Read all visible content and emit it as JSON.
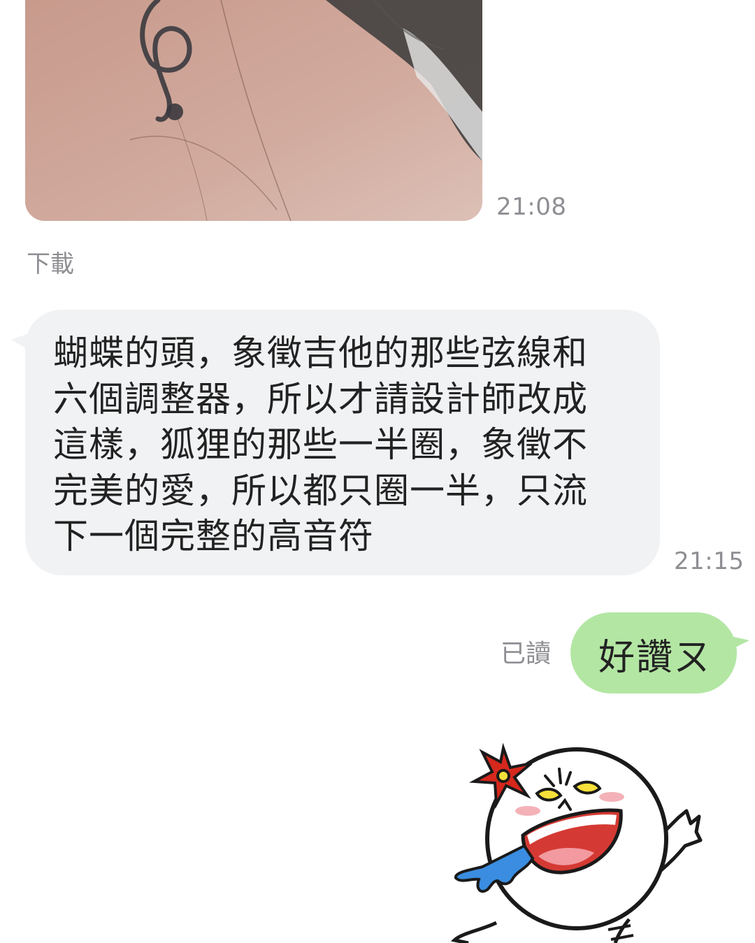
{
  "messages": {
    "photo": {
      "time": "21:08",
      "download_label": "下載"
    },
    "incoming_text": {
      "lines": [
        "蝴蝶的頭，象徵吉他的那些弦線和",
        "六個調整器，所以才請設計師改成",
        "這樣，狐狸的那些一半圈，象徵不",
        "完美的愛，所以都只圈一半，只流",
        "下一個完整的高音符"
      ],
      "time": "21:15"
    },
    "outgoing_text": {
      "read_status": "已讀",
      "text": "好讚ㄡ"
    },
    "sticker": {
      "icon": "laughing-moon-sticker"
    }
  },
  "colors": {
    "incoming_bubble": "#f1f2f4",
    "outgoing_bubble": "#b3e6a3",
    "meta_text": "#8e8e93"
  }
}
